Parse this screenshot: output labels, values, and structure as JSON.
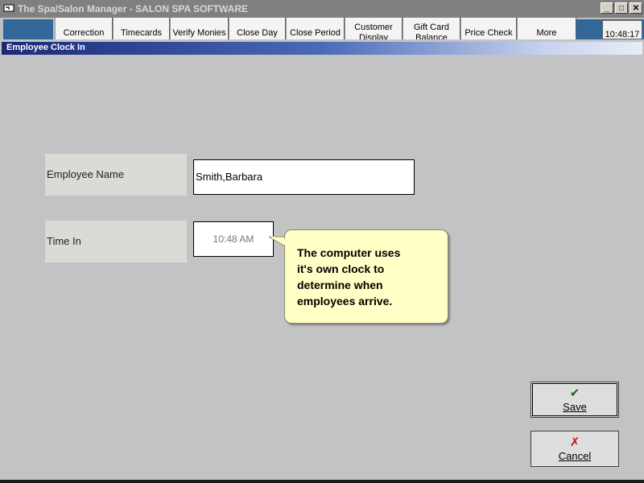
{
  "window": {
    "title": "The Spa/Salon Manager - SALON SPA SOFTWARE",
    "controls": {
      "minimize": "_",
      "maximize": "□",
      "close": "✕"
    }
  },
  "toolbar": {
    "buttons": [
      {
        "label": "Correction"
      },
      {
        "label": "Timecards"
      },
      {
        "label": "Verify Monies"
      },
      {
        "label": "Close Day"
      },
      {
        "label": "Close Period"
      },
      {
        "label_line1": "Customer",
        "label_line2": "Display"
      },
      {
        "label_line1": "Gift Card",
        "label_line2": "Balance"
      },
      {
        "label": "Price Check"
      },
      {
        "label": "More"
      }
    ],
    "clock": "10:48:17"
  },
  "section": {
    "title": "Employee Clock In"
  },
  "form": {
    "employee_name_label": "Employee Name",
    "employee_name_value": "Smith,Barbara",
    "time_in_label": "Time In",
    "time_in_value": "10:48 AM"
  },
  "tooltip": {
    "line1": "The computer uses",
    "line2": "it's own clock to",
    "line3": "determine when",
    "line4": "employees arrive."
  },
  "actions": {
    "save": {
      "glyph": "✔",
      "label_first": "S",
      "label_rest": "ave",
      "glyph_color": "#1a6a1a"
    },
    "cancel": {
      "glyph": "✗",
      "label_first": "C",
      "label_rest": "ancel",
      "glyph_color": "#cc1111"
    }
  }
}
